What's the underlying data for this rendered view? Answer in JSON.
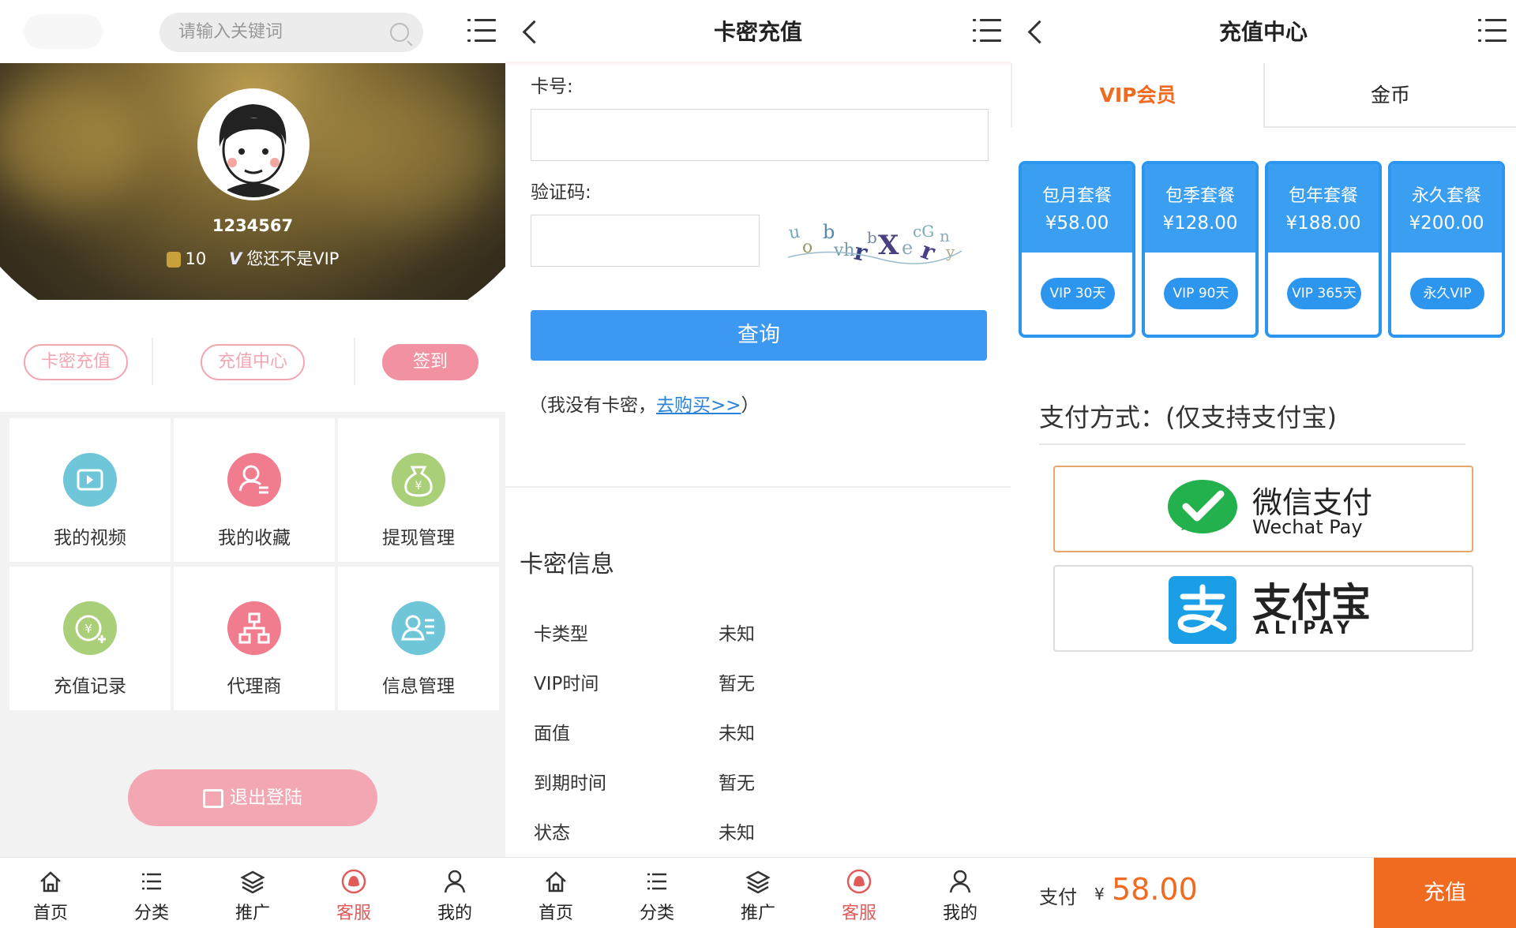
{
  "panel1": {
    "search_placeholder": "请输入关键词",
    "user": {
      "id": "1234567",
      "coins": "10",
      "vip_status": "您还不是VIP"
    },
    "actions": {
      "card_recharge": "卡密充值",
      "recharge_center": "充值中心",
      "sign_in": "签到"
    },
    "grid": [
      {
        "label": "我的视频",
        "icon": "video-icon",
        "color": "#6ec6d8"
      },
      {
        "label": "我的收藏",
        "icon": "favorite-user-icon",
        "color": "#f07c8e"
      },
      {
        "label": "提现管理",
        "icon": "money-bag-icon",
        "color": "#a9cf79"
      },
      {
        "label": "充值记录",
        "icon": "yen-add-icon",
        "color": "#a9cf79"
      },
      {
        "label": "代理商",
        "icon": "agent-tree-icon",
        "color": "#f07c8e"
      },
      {
        "label": "信息管理",
        "icon": "user-info-icon",
        "color": "#6ec6d8"
      }
    ],
    "logout": "退出登陆"
  },
  "nav": [
    {
      "label": "首页",
      "icon": "home-icon",
      "active": false
    },
    {
      "label": "分类",
      "icon": "list-icon",
      "active": false
    },
    {
      "label": "推广",
      "icon": "layers-icon",
      "active": false
    },
    {
      "label": "客服",
      "icon": "support-icon",
      "active": true
    },
    {
      "label": "我的",
      "icon": "user-icon",
      "active": false
    }
  ],
  "panel2": {
    "title": "卡密充值",
    "card_no_label": "卡号:",
    "captcha_label": "验证码:",
    "query_button": "查询",
    "no_card_prefix": "（我没有卡密，",
    "buy_link": "去购买>>",
    "no_card_suffix": "）",
    "info_title": "卡密信息",
    "info": [
      {
        "key": "卡类型",
        "value": "未知"
      },
      {
        "key": "VIP时间",
        "value": "暂无"
      },
      {
        "key": "面值",
        "value": "未知"
      },
      {
        "key": "到期时间",
        "value": "暂无"
      },
      {
        "key": "状态",
        "value": "未知"
      }
    ]
  },
  "panel3": {
    "title": "充值中心",
    "tabs": [
      {
        "label": "VIP会员",
        "active": true
      },
      {
        "label": "金币",
        "active": false
      }
    ],
    "packages": [
      {
        "name": "包月套餐",
        "price": "¥58.00",
        "badge": "VIP 30天"
      },
      {
        "name": "包季套餐",
        "price": "¥128.00",
        "badge": "VIP 90天"
      },
      {
        "name": "包年套餐",
        "price": "¥188.00",
        "badge": "VIP 365天"
      },
      {
        "name": "永久套餐",
        "price": "¥200.00",
        "badge": "永久VIP"
      }
    ],
    "pay_method_title": "支付方式：(仅支持支付宝)",
    "wechat": {
      "cn": "微信支付",
      "en": "Wechat Pay"
    },
    "alipay": {
      "cn": "支付宝",
      "en": "ALIPAY"
    },
    "pay_label": "支付",
    "currency": "¥",
    "amount": "58.00",
    "recharge_button": "充值"
  },
  "colors": {
    "accent_pink": "#f291a1",
    "accent_blue": "#3d98f2",
    "accent_orange": "#f06a1f",
    "active_nav": "#e25a5a"
  }
}
